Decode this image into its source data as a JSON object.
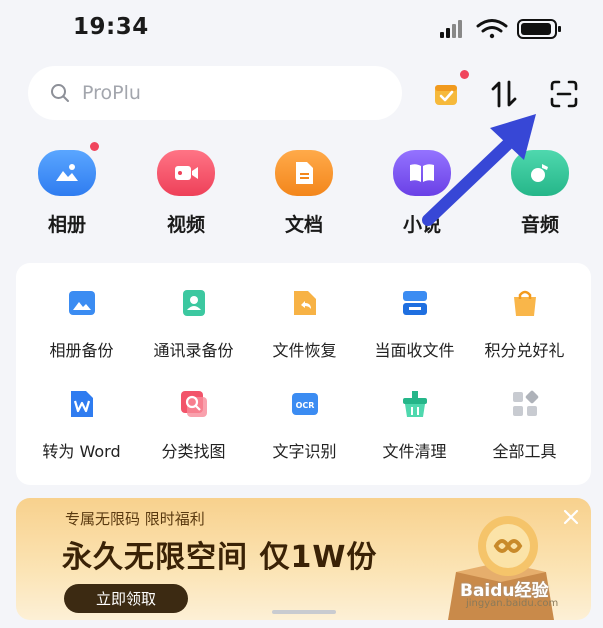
{
  "status_bar": {
    "time": "19:34"
  },
  "search": {
    "placeholder": "ProPlu"
  },
  "categories": [
    {
      "label": "相册",
      "color": "#3a8ef5"
    },
    {
      "label": "视频",
      "color": "#f2546a"
    },
    {
      "label": "文档",
      "color": "#f5962e"
    },
    {
      "label": "小说",
      "color": "#7a52ea"
    },
    {
      "label": "音频",
      "color": "#34c39a"
    }
  ],
  "tools": [
    {
      "label": "相册备份",
      "icon": "photo-backup-icon"
    },
    {
      "label": "通讯录备份",
      "icon": "contacts-backup-icon"
    },
    {
      "label": "文件恢复",
      "icon": "file-restore-icon"
    },
    {
      "label": "当面收文件",
      "icon": "receive-file-icon"
    },
    {
      "label": "积分兑好礼",
      "icon": "gift-bag-icon"
    },
    {
      "label": "转为 Word",
      "icon": "word-convert-icon"
    },
    {
      "label": "分类找图",
      "icon": "image-search-icon"
    },
    {
      "label": "文字识别",
      "icon": "ocr-icon"
    },
    {
      "label": "文件清理",
      "icon": "file-clean-icon"
    },
    {
      "label": "全部工具",
      "icon": "all-tools-icon"
    }
  ],
  "banner": {
    "subtitle": "专属无限码 限时福利",
    "headline": "永久无限空间 仅1W份",
    "cta": "立即领取"
  },
  "watermark": {
    "brand": "Baidu经验",
    "url": "jingyan.baidu.com"
  }
}
